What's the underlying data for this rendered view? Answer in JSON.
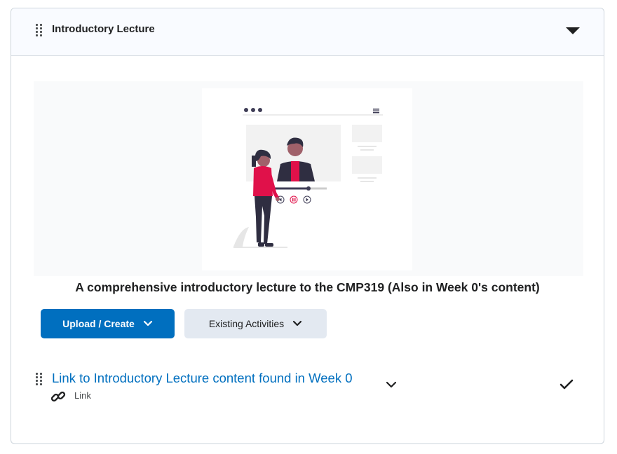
{
  "module": {
    "title": "Introductory Lecture",
    "icons": {
      "drag": "drag-handle-icon",
      "toggle": "caret-down-icon"
    }
  },
  "content": {
    "description": "A comprehensive introductory lecture to the CMP319 (Also in Week 0's content)"
  },
  "actions": {
    "upload_create_label": "Upload / Create",
    "existing_activities_label": "Existing Activities"
  },
  "items": [
    {
      "title": "Link to Introductory Lecture content found in Week 0",
      "type_label": "Link",
      "type_icon": "link-icon",
      "status_icon": "checkmark-icon"
    }
  ],
  "colors": {
    "accent": "#006fbf",
    "illustration_accent": "#e0114a"
  }
}
